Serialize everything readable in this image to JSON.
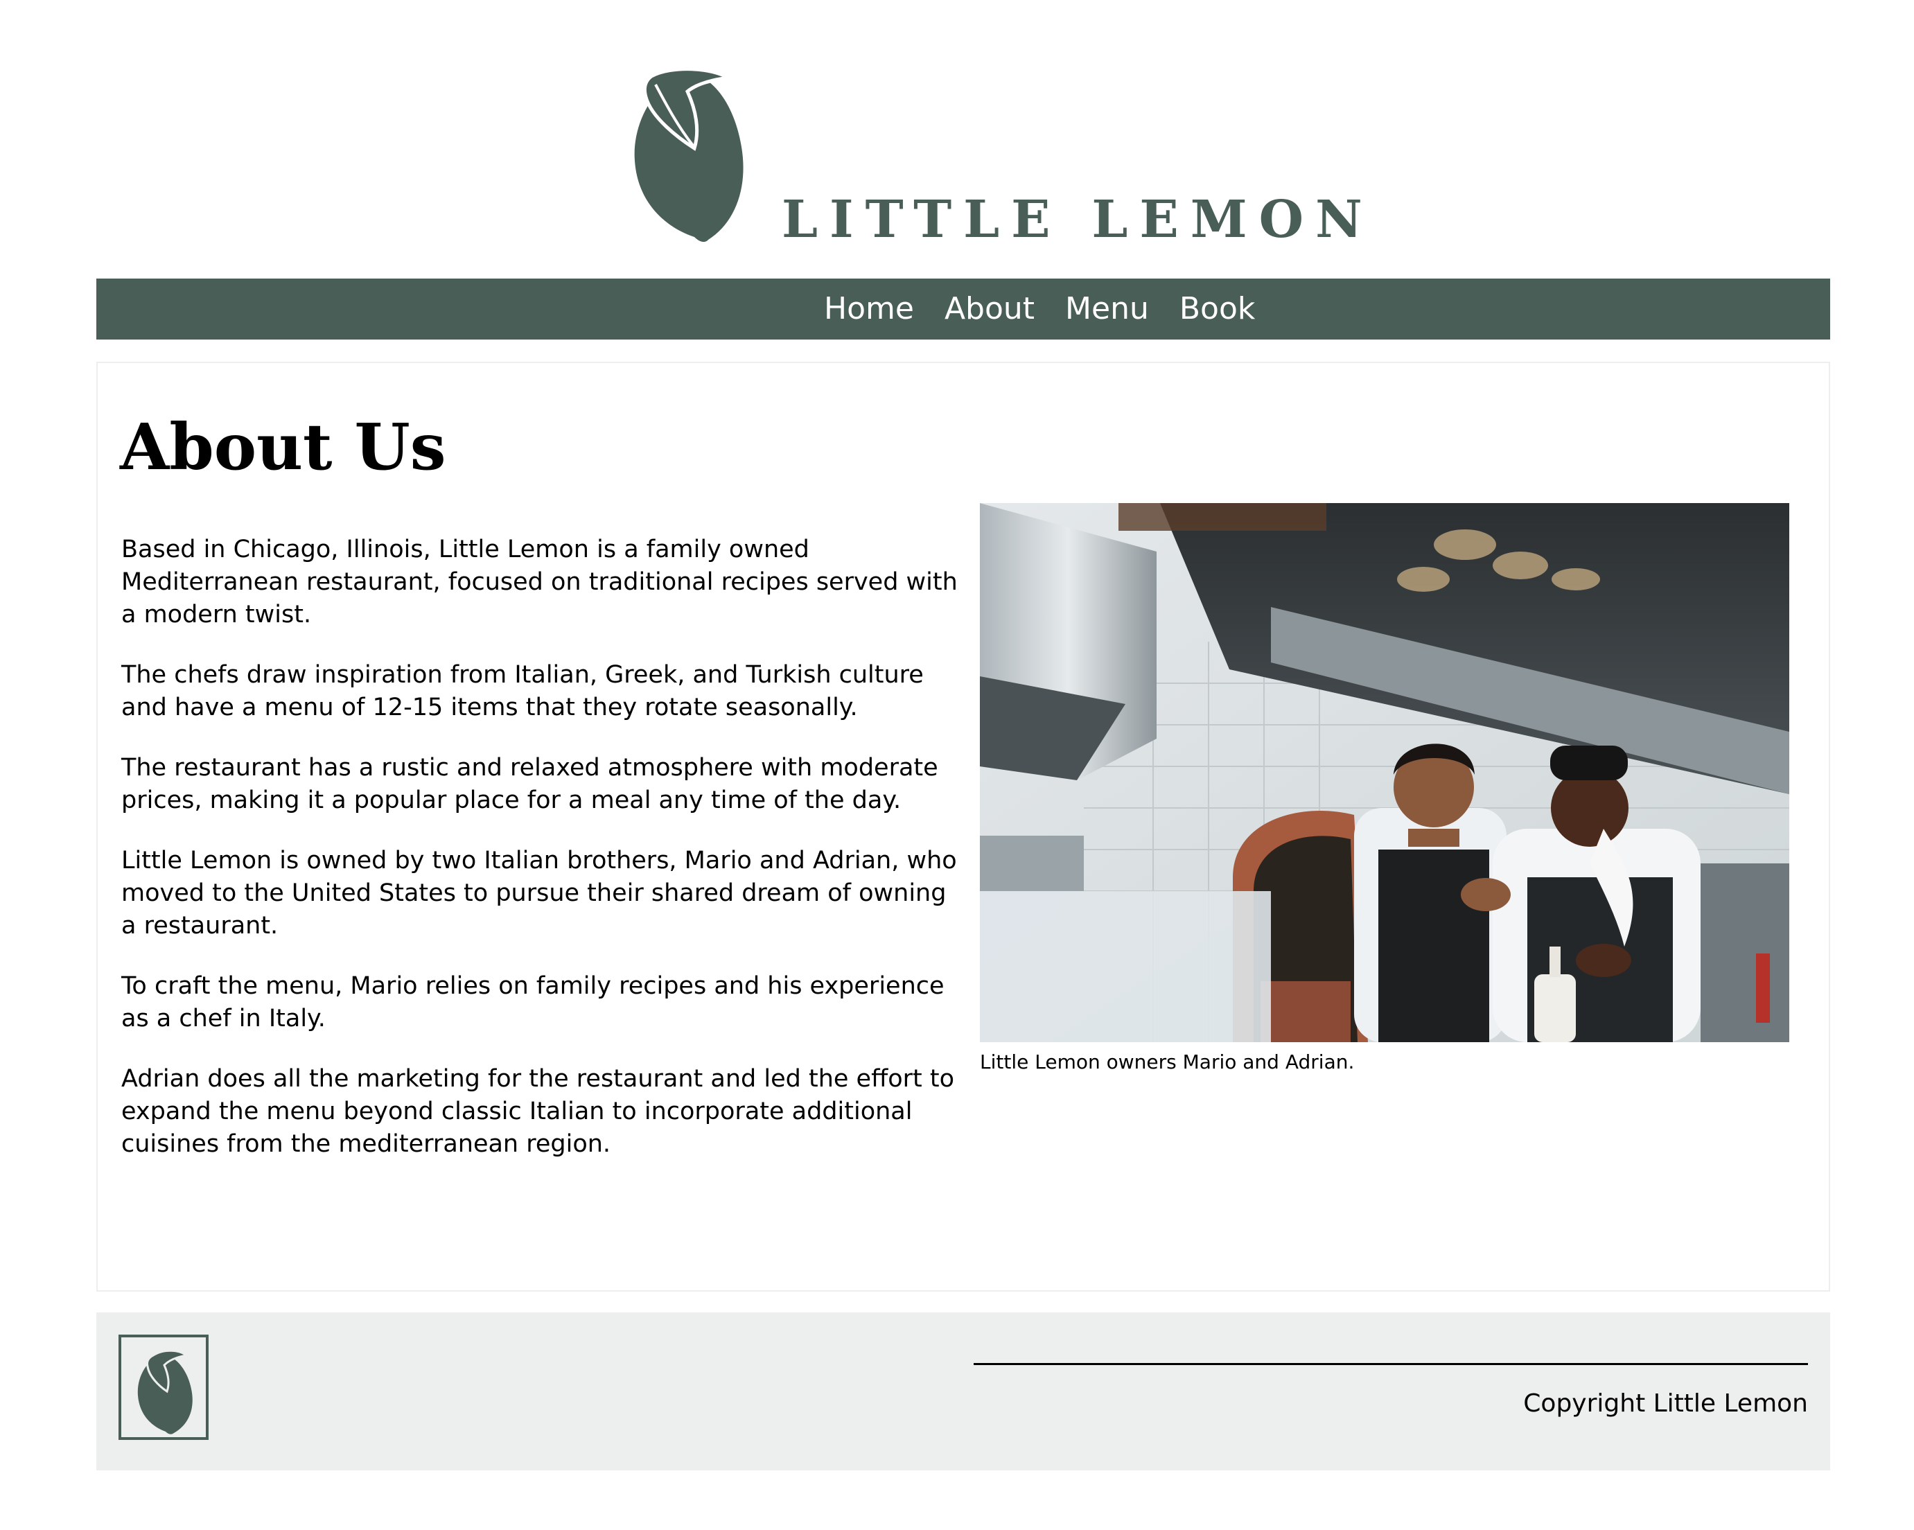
{
  "brand": {
    "name": "LITTLE LEMON",
    "primary_color": "#495e57",
    "footer_background": "#edefee",
    "logo_icon": "lemon-icon"
  },
  "nav": {
    "items": [
      {
        "label": "Home"
      },
      {
        "label": "About"
      },
      {
        "label": "Menu"
      },
      {
        "label": "Book"
      }
    ]
  },
  "main": {
    "title": "About Us",
    "paragraphs": [
      "Based in Chicago, Illinois, Little Lemon is a family owned Mediterranean restaurant, focused on traditional recipes served with a modern twist.",
      "The chefs draw inspiration from Italian, Greek, and Turkish culture and have a menu of 12-15 items that they rotate seasonally.",
      "The restaurant has a rustic and relaxed atmosphere with moderate prices, making it a popular place for a meal any time of the day.",
      "Little Lemon is owned by two Italian brothers, Mario and Adrian, who moved to the United States to pursue their shared dream of owning a restaurant.",
      "To craft the menu, Mario relies on family recipes and his experience as a chef in Italy.",
      "Adrian does all the marketing for the restaurant and led the effort to expand the menu beyond classic Italian to incorporate additional cuisines from the mediterranean region."
    ],
    "figure": {
      "caption": "Little Lemon owners Mario and Adrian."
    }
  },
  "footer": {
    "copyright": "Copyright Little Lemon"
  }
}
